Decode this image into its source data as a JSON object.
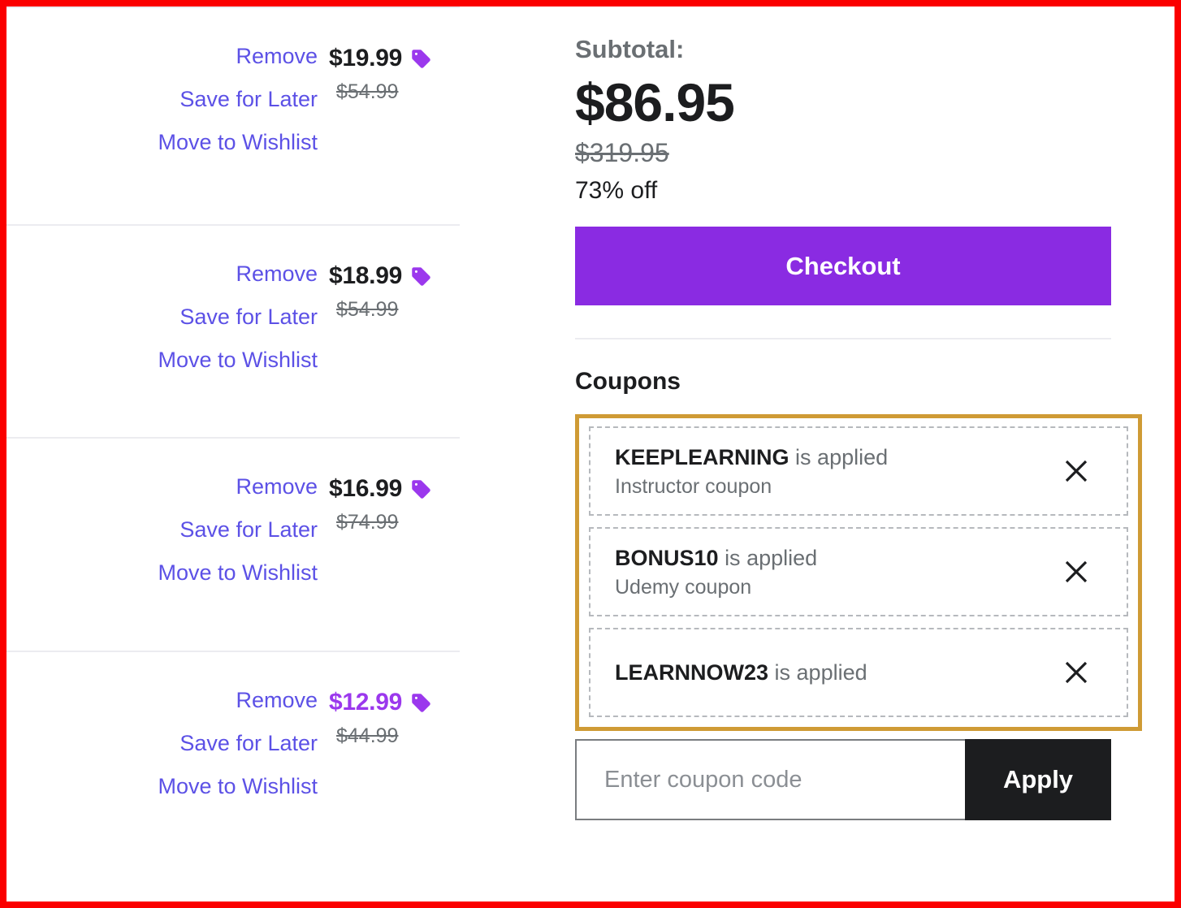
{
  "cart": {
    "items": [
      {
        "remove_label": "Remove",
        "save_label": "Save for Later",
        "wishlist_label": "Move to Wishlist",
        "price": "$19.99",
        "original_price": "$54.99",
        "price_highlighted": false
      },
      {
        "remove_label": "Remove",
        "save_label": "Save for Later",
        "wishlist_label": "Move to Wishlist",
        "price": "$18.99",
        "original_price": "$54.99",
        "price_highlighted": false
      },
      {
        "remove_label": "Remove",
        "save_label": "Save for Later",
        "wishlist_label": "Move to Wishlist",
        "price": "$16.99",
        "original_price": "$74.99",
        "price_highlighted": false
      },
      {
        "remove_label": "Remove",
        "save_label": "Save for Later",
        "wishlist_label": "Move to Wishlist",
        "price": "$12.99",
        "original_price": "$44.99",
        "price_highlighted": true
      }
    ]
  },
  "summary": {
    "subtotal_label": "Subtotal:",
    "subtotal_amount": "$86.95",
    "subtotal_original": "$319.95",
    "discount_text": "73% off",
    "checkout_label": "Checkout"
  },
  "coupons": {
    "heading": "Coupons",
    "applied": [
      {
        "code": "KEEPLEARNING",
        "status": "is applied",
        "source": "Instructor coupon"
      },
      {
        "code": "BONUS10",
        "status": "is applied",
        "source": "Udemy coupon"
      },
      {
        "code": "LEARNNOW23",
        "status": "is applied",
        "source": ""
      }
    ],
    "input_placeholder": "Enter coupon code",
    "input_value": "",
    "apply_label": "Apply"
  },
  "colors": {
    "accent_purple": "#8a2be2",
    "link_purple": "#5c51e6",
    "discount_purple": "#9b38ed",
    "highlight_border": "#cf9b35",
    "screenshot_border": "#fb0000",
    "dark": "#1c1d1f",
    "muted": "#6a6f73"
  },
  "icons": {
    "tag": "tag-icon",
    "close": "close-icon"
  }
}
